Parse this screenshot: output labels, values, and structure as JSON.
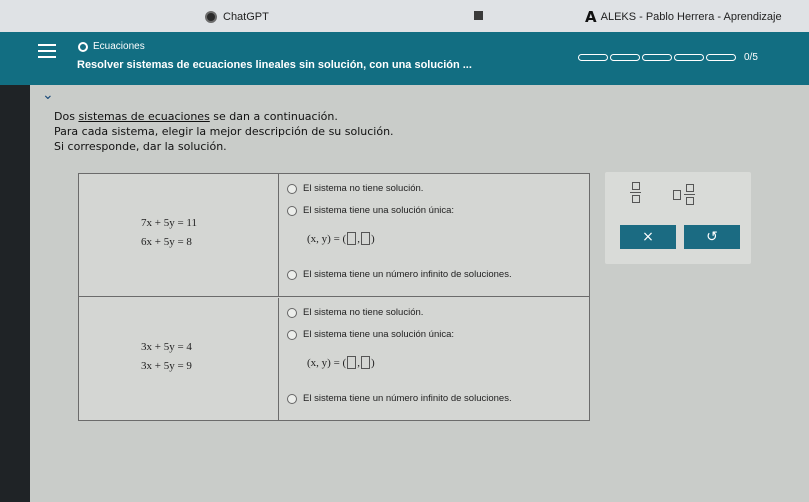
{
  "browser": {
    "tabs": [
      {
        "label": "ChatGPT"
      },
      {
        "label": "ALEKS - Pablo Herrera - Aprendizaje"
      }
    ]
  },
  "header": {
    "topic": "Ecuaciones",
    "title": "Resolver sistemas de ecuaciones lineales sin solución, con una solución ...",
    "progress_label": "0/5",
    "progress_fraction": 0
  },
  "instructions": {
    "line1_pre": "Dos ",
    "line1_link": "sistemas de ecuaciones",
    "line1_post": " se dan a continuación.",
    "line2": "Para cada sistema, elegir la mejor descripción de su solución.",
    "line3": "Si corresponde, dar la solución."
  },
  "systems": [
    {
      "eq1": "7x + 5y = 11",
      "eq2": "6x + 5y = 8",
      "opt_none": "El sistema no tiene solución.",
      "opt_unique": "El sistema tiene una solución única:",
      "solution_prefix": "(x, y) = (",
      "solution_comma": ",",
      "solution_suffix": ")",
      "opt_infinite": "El sistema tiene un número infinito de soluciones."
    },
    {
      "eq1": "3x + 5y = 4",
      "eq2": "3x + 5y = 9",
      "opt_none": "El sistema no tiene solución.",
      "opt_unique": "El sistema tiene una solución única:",
      "solution_prefix": "(x, y) = (",
      "solution_comma": ",",
      "solution_suffix": ")",
      "opt_infinite": "El sistema tiene un número infinito de soluciones."
    }
  ],
  "tools": {
    "clear_symbol": "×",
    "undo_symbol": "↺"
  }
}
